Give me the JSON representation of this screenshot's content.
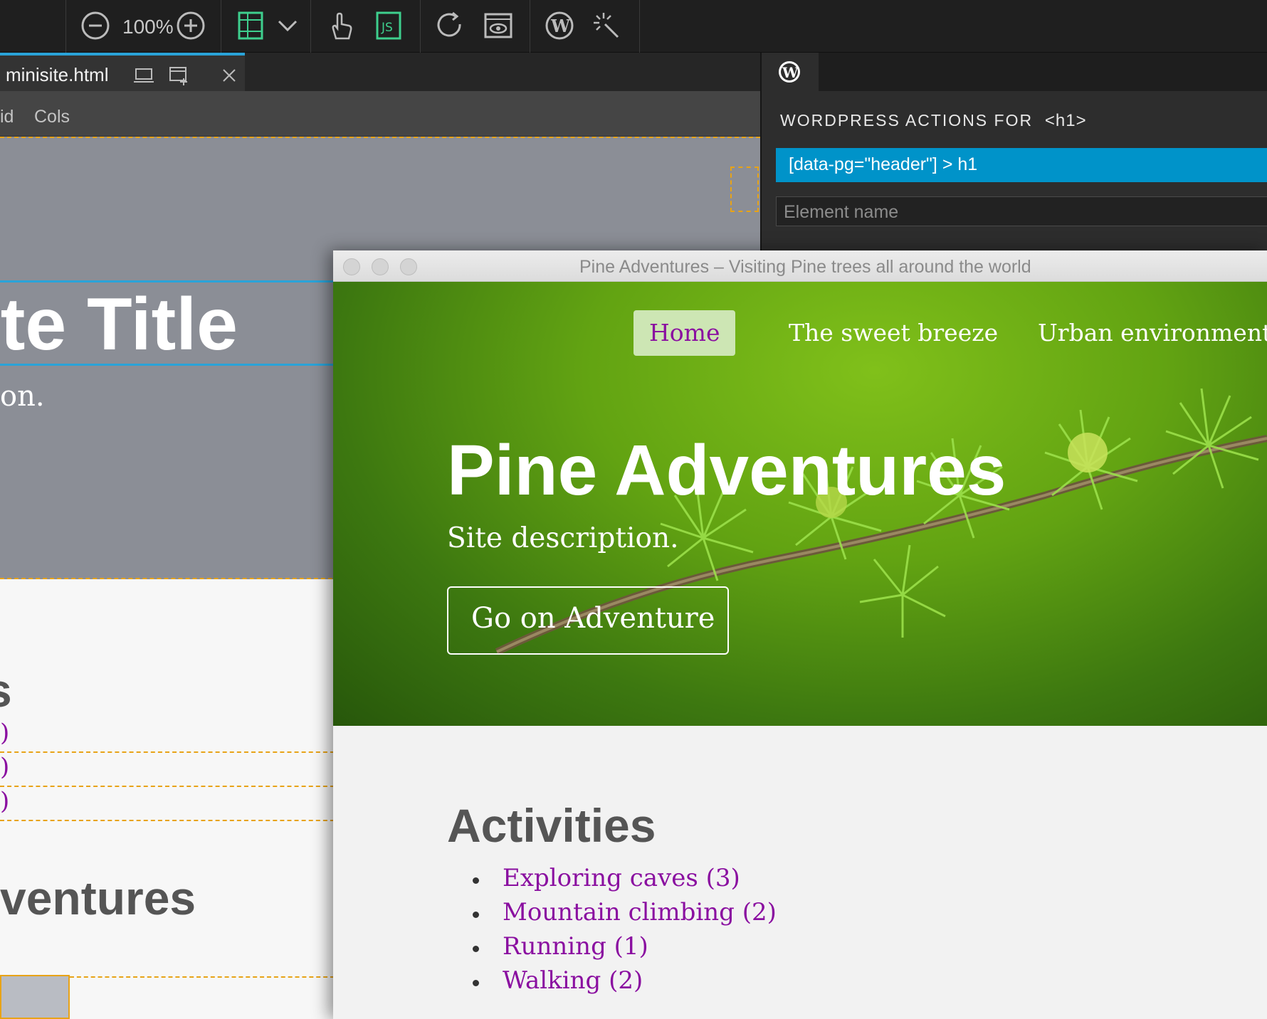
{
  "toolbar": {
    "zoom": "100%",
    "icons": [
      "zoom-out-icon",
      "zoom-in-icon",
      "grid-icon",
      "chevron-down-icon",
      "hand-pointer-icon",
      "js-icon",
      "refresh-icon",
      "preview-icon",
      "wordpress-icon",
      "magic-wand-icon"
    ]
  },
  "editor_tab": {
    "filename": "minisite.html"
  },
  "subbar": {
    "grid_label": "id",
    "cols_label": "Cols"
  },
  "canvas": {
    "title_fragment": "ite Title",
    "desc_fragment": "on.",
    "heading_fragment": "s",
    "list_fragments": [
      ")",
      ")",
      ")"
    ],
    "heading2_fragment": "ventures"
  },
  "panel": {
    "heading": "WORDPRESS ACTIONS FOR",
    "heading_tag": "<h1>",
    "selector": "[data-pg=\"header\"] > h1",
    "element_name_placeholder": "Element name"
  },
  "browser": {
    "window_title": "Pine Adventures – Visiting Pine trees all around the world",
    "nav": [
      "Home",
      "The sweet breeze",
      "Urban environments"
    ],
    "hero_title": "Pine Adventures",
    "hero_desc": "Site description.",
    "hero_button": "Go on Adventure",
    "activities_heading": "Activities",
    "activities": [
      "Exploring caves (3)",
      "Mountain climbing (2)",
      "Running (1)",
      "Walking (2)"
    ]
  },
  "colors": {
    "accent_blue": "#0093c9",
    "guide_orange": "#e8a317",
    "link_purple": "#8a0fa0",
    "hero_green": "#62a312"
  }
}
